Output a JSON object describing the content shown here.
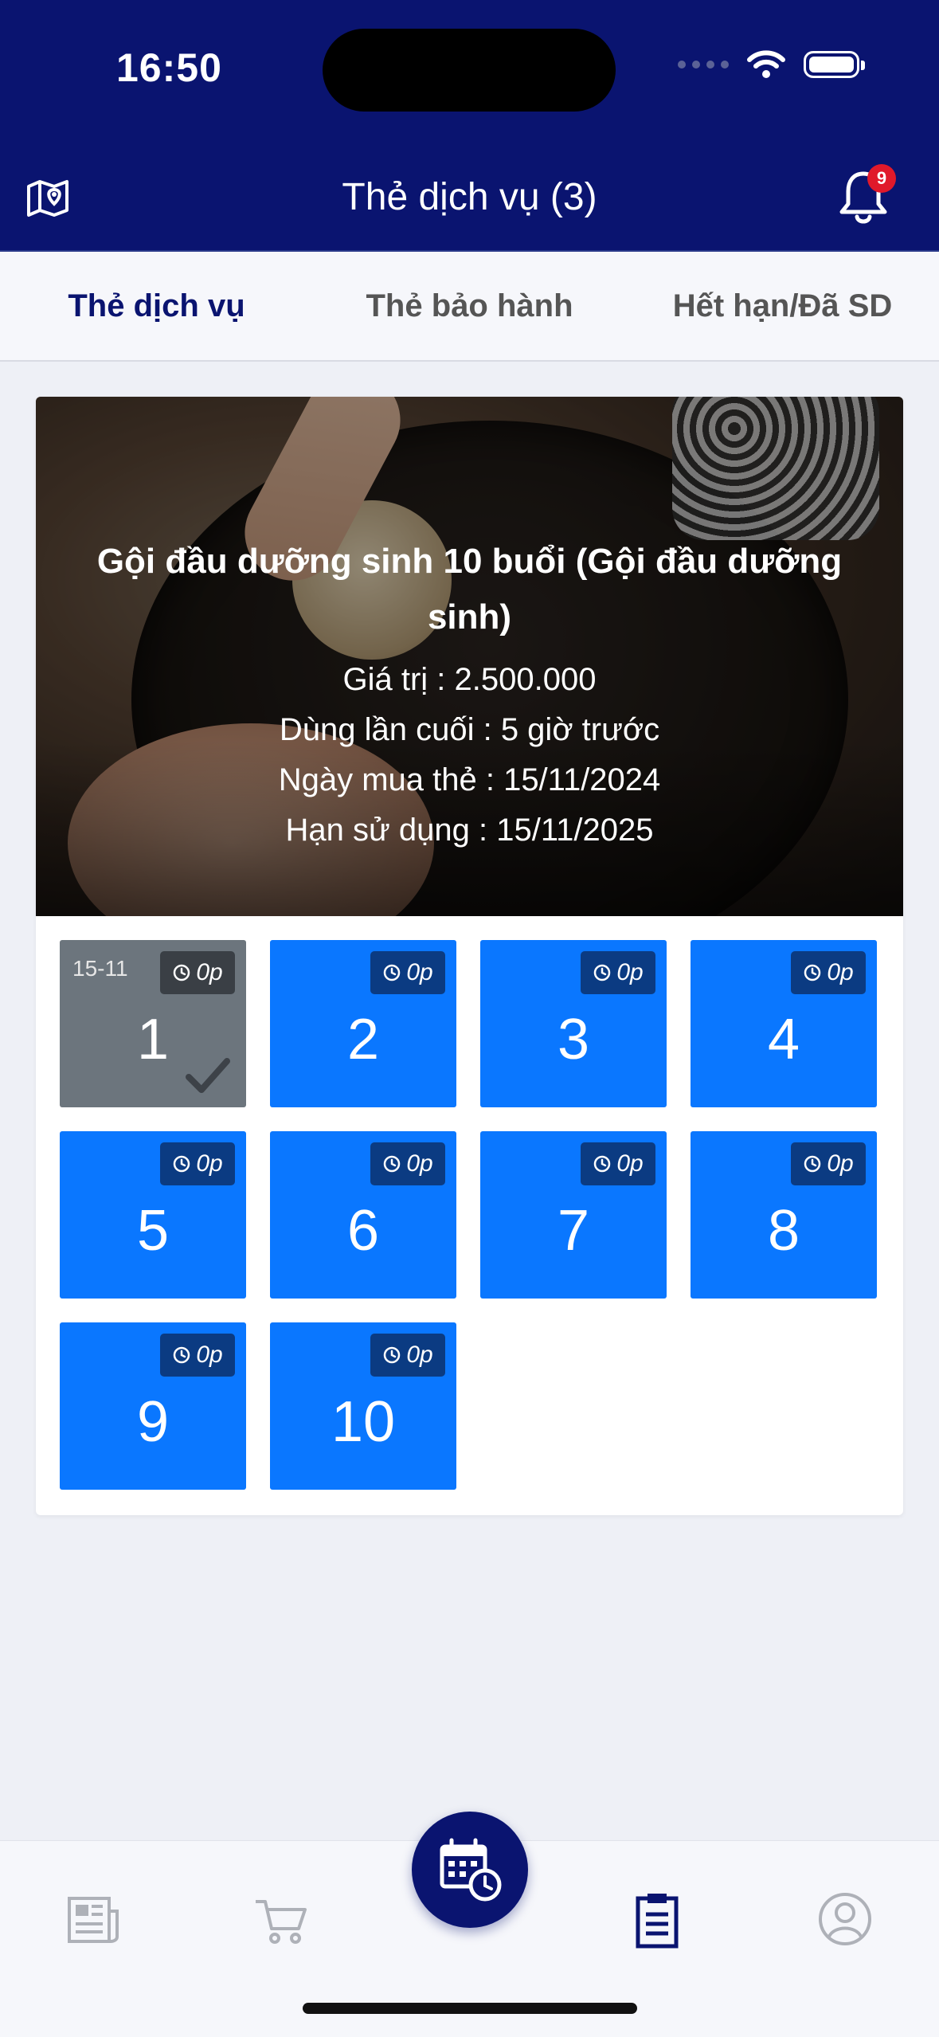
{
  "status_bar": {
    "time": "16:50"
  },
  "header": {
    "title": "Thẻ dịch vụ (3)",
    "notification_count": "9"
  },
  "tabs": [
    {
      "label": "Thẻ dịch vụ",
      "active": true
    },
    {
      "label": "Thẻ bảo hành",
      "active": false
    },
    {
      "label": "Hết hạn/Đã SD",
      "active": false
    }
  ],
  "card": {
    "title": "Gội đầu dưỡng sinh 10 buổi (Gội đầu dưỡng sinh)",
    "value_line": "Giá trị : 2.500.000",
    "last_used_line": "Dùng lần cuối : 5 giờ trước",
    "purchase_date_line": "Ngày mua thẻ : 15/11/2024",
    "expiry_line": "Hạn sử dụng : 15/11/2025"
  },
  "sessions": [
    {
      "number": "1",
      "duration": "0p",
      "used": true,
      "date": "15-11"
    },
    {
      "number": "2",
      "duration": "0p",
      "used": false
    },
    {
      "number": "3",
      "duration": "0p",
      "used": false
    },
    {
      "number": "4",
      "duration": "0p",
      "used": false
    },
    {
      "number": "5",
      "duration": "0p",
      "used": false
    },
    {
      "number": "6",
      "duration": "0p",
      "used": false
    },
    {
      "number": "7",
      "duration": "0p",
      "used": false
    },
    {
      "number": "8",
      "duration": "0p",
      "used": false
    },
    {
      "number": "9",
      "duration": "0p",
      "used": false
    },
    {
      "number": "10",
      "duration": "0p",
      "used": false
    }
  ],
  "bottom_nav": [
    {
      "icon": "news-icon",
      "active": false
    },
    {
      "icon": "cart-icon",
      "active": false
    },
    {
      "icon": "calendar-clock-icon",
      "active": false,
      "featured": true
    },
    {
      "icon": "clipboard-icon",
      "active": true
    },
    {
      "icon": "user-icon",
      "active": false
    }
  ],
  "colors": {
    "header_bg": "#0a1470",
    "session_active": "#0a77ff",
    "session_used": "#6c757d",
    "badge": "#e0192b"
  }
}
